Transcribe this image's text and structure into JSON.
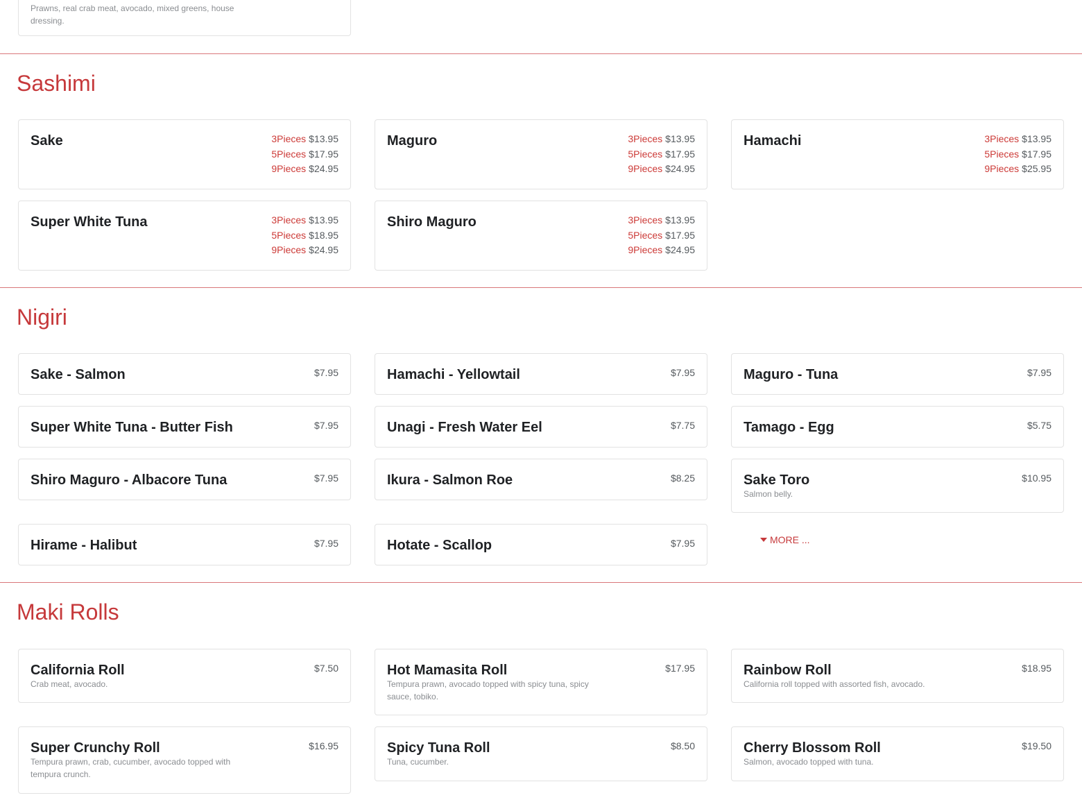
{
  "top_partial": {
    "desc": "Prawns, real crab meat, avocado, mixed greens, house dressing."
  },
  "sashimi": {
    "title": "Sashimi",
    "items": [
      {
        "name": "Sake",
        "tiers": [
          {
            "qty": "3Pieces",
            "price": "$13.95"
          },
          {
            "qty": "5Pieces",
            "price": "$17.95"
          },
          {
            "qty": "9Pieces",
            "price": "$24.95"
          }
        ]
      },
      {
        "name": "Maguro",
        "tiers": [
          {
            "qty": "3Pieces",
            "price": "$13.95"
          },
          {
            "qty": "5Pieces",
            "price": "$17.95"
          },
          {
            "qty": "9Pieces",
            "price": "$24.95"
          }
        ]
      },
      {
        "name": "Hamachi",
        "tiers": [
          {
            "qty": "3Pieces",
            "price": "$13.95"
          },
          {
            "qty": "5Pieces",
            "price": "$17.95"
          },
          {
            "qty": "9Pieces",
            "price": "$25.95"
          }
        ]
      },
      {
        "name": "Super White Tuna",
        "tiers": [
          {
            "qty": "3Pieces",
            "price": "$13.95"
          },
          {
            "qty": "5Pieces",
            "price": "$18.95"
          },
          {
            "qty": "9Pieces",
            "price": "$24.95"
          }
        ]
      },
      {
        "name": "Shiro Maguro",
        "tiers": [
          {
            "qty": "3Pieces",
            "price": "$13.95"
          },
          {
            "qty": "5Pieces",
            "price": "$17.95"
          },
          {
            "qty": "9Pieces",
            "price": "$24.95"
          }
        ]
      }
    ]
  },
  "nigiri": {
    "title": "Nigiri",
    "more_label": "MORE ...",
    "items": [
      {
        "name": "Sake - Salmon",
        "price": "$7.95"
      },
      {
        "name": "Hamachi - Yellowtail",
        "price": "$7.95"
      },
      {
        "name": "Maguro - Tuna",
        "price": "$7.95"
      },
      {
        "name": "Super White Tuna - Butter Fish",
        "price": "$7.95"
      },
      {
        "name": "Unagi - Fresh Water Eel",
        "price": "$7.75"
      },
      {
        "name": "Tamago - Egg",
        "price": "$5.75"
      },
      {
        "name": "Shiro Maguro - Albacore Tuna",
        "price": "$7.95"
      },
      {
        "name": "Ikura - Salmon Roe",
        "price": "$8.25"
      },
      {
        "name": "Sake Toro",
        "price": "$10.95",
        "desc": "Salmon belly."
      },
      {
        "name": "Hirame - Halibut",
        "price": "$7.95"
      },
      {
        "name": "Hotate - Scallop",
        "price": "$7.95"
      }
    ]
  },
  "maki": {
    "title": "Maki Rolls",
    "items": [
      {
        "name": "California Roll",
        "price": "$7.50",
        "desc": "Crab meat, avocado."
      },
      {
        "name": "Hot Mamasita Roll",
        "price": "$17.95",
        "desc": "Tempura prawn, avocado topped with spicy tuna, spicy sauce, tobiko."
      },
      {
        "name": "Rainbow Roll",
        "price": "$18.95",
        "desc": "California roll topped with assorted fish, avocado."
      },
      {
        "name": "Super Crunchy Roll",
        "price": "$16.95",
        "desc": "Tempura prawn, crab, cucumber, avocado topped with tempura crunch."
      },
      {
        "name": "Spicy Tuna Roll",
        "price": "$8.50",
        "desc": "Tuna, cucumber."
      },
      {
        "name": "Cherry Blossom Roll",
        "price": "$19.50",
        "desc": "Salmon, avocado topped with tuna."
      }
    ]
  },
  "colors": {
    "accent": "#c6393b",
    "divider": "#d9777a",
    "card_border": "#e2e2e2"
  }
}
